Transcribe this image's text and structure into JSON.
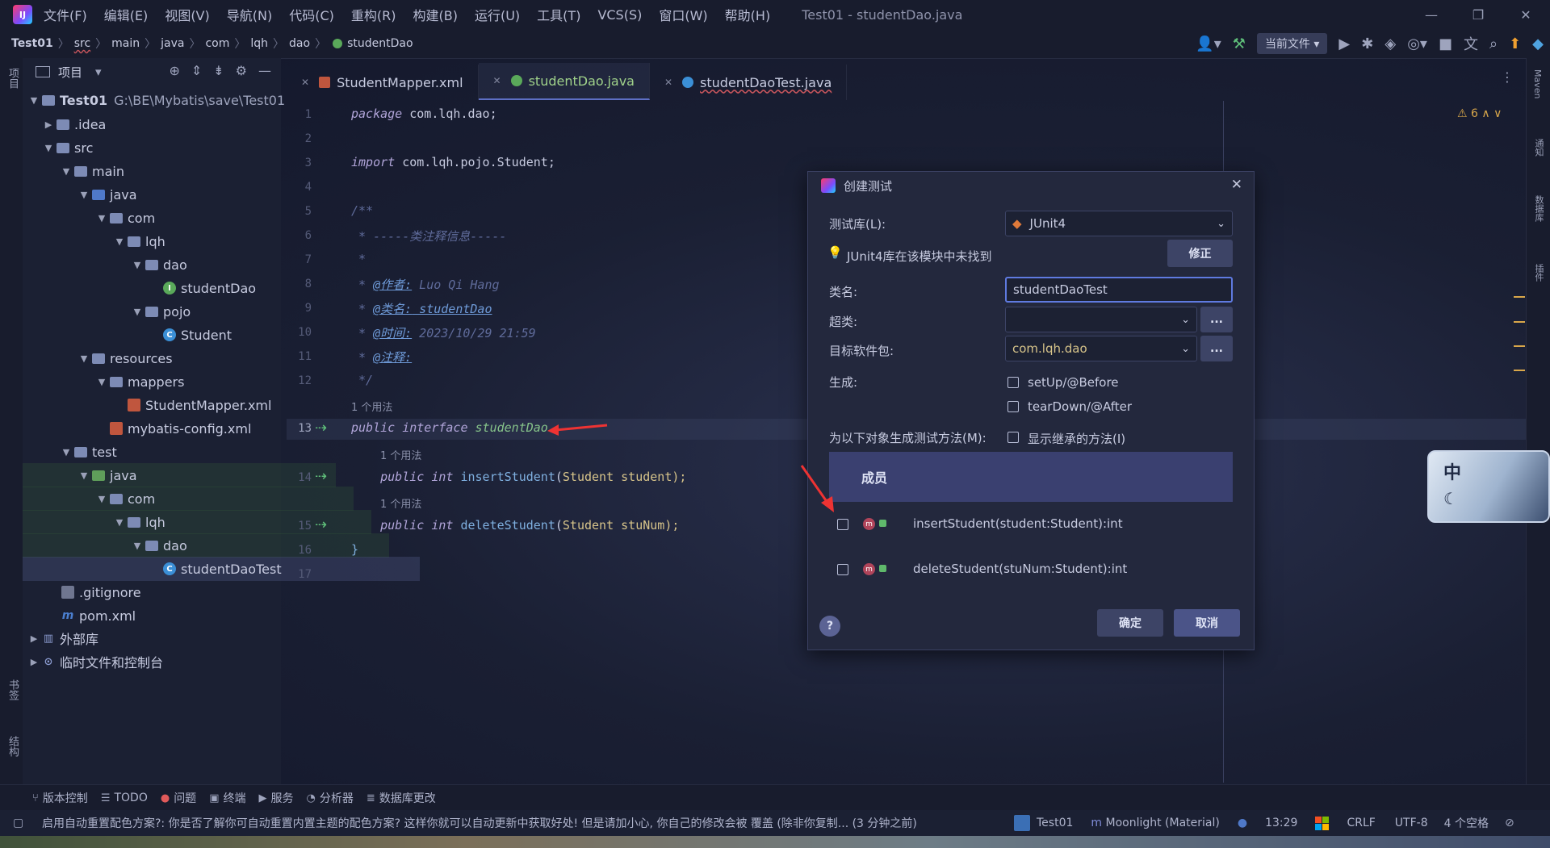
{
  "window": {
    "title": "Test01 - studentDao.java",
    "menu": [
      "文件(F)",
      "编辑(E)",
      "视图(V)",
      "导航(N)",
      "代码(C)",
      "重构(R)",
      "构建(B)",
      "运行(U)",
      "工具(T)",
      "VCS(S)",
      "窗口(W)",
      "帮助(H)"
    ]
  },
  "breadcrumb": [
    "Test01",
    "src",
    "main",
    "java",
    "com",
    "lqh",
    "dao",
    "studentDao"
  ],
  "toolbar": {
    "run_config": "当前文件"
  },
  "left_strip": {
    "project_label": "项目",
    "bookmarks_label": "书签",
    "structure_label": "结构"
  },
  "right_strip": {
    "maven": "Maven",
    "notifications": "通知",
    "database": "数据库",
    "plugins": "插件"
  },
  "project_panel": {
    "title": "项目",
    "root_name": "Test01",
    "root_path": "G:\\BE\\Mybatis\\save\\Test01",
    "items": [
      {
        "label": ".idea"
      },
      {
        "label": "src"
      },
      {
        "label": "main"
      },
      {
        "label": "java"
      },
      {
        "label": "com"
      },
      {
        "label": "lqh"
      },
      {
        "label": "dao"
      },
      {
        "label": "studentDao"
      },
      {
        "label": "pojo"
      },
      {
        "label": "Student"
      },
      {
        "label": "resources"
      },
      {
        "label": "mappers"
      },
      {
        "label": "StudentMapper.xml"
      },
      {
        "label": "mybatis-config.xml"
      },
      {
        "label": "test"
      },
      {
        "label": "java"
      },
      {
        "label": "com"
      },
      {
        "label": "lqh"
      },
      {
        "label": "dao"
      },
      {
        "label": "studentDaoTest"
      },
      {
        "label": ".gitignore"
      },
      {
        "label": "pom.xml"
      },
      {
        "label": "外部库"
      },
      {
        "label": "临时文件和控制台"
      }
    ]
  },
  "tabs": [
    {
      "label": "StudentMapper.xml"
    },
    {
      "label": "studentDao.java"
    },
    {
      "label": "studentDaoTest.java"
    }
  ],
  "editor": {
    "warnings": "6",
    "lines": {
      "l1_kw": "package",
      "l1_rest": " com.lqh.dao;",
      "l3_kw": "import",
      "l3_rest": " com.lqh.pojo.Student;",
      "l5": "/**",
      "l6": " * -----类注释信息-----",
      "l7": " *",
      "l8_tag": "@作者:",
      "l8_val": " Luo Qi Hang",
      "l9_tag": "@类名:",
      "l9_val": " studentDao",
      "l10_tag": "@时间:",
      "l10_val": " 2023/10/29 21:59",
      "l11_tag": "@注释:",
      "l12": " */",
      "usage1": "1 个用法",
      "l13_kw": "public interface",
      "l13_name": "studentDao",
      "usage2": "1 个用法",
      "l14_kw": "public int",
      "l14_method": "insertStudent",
      "l14_type": "Student",
      "l14_param": " student);",
      "usage3": "1 个用法",
      "l15_kw": "public int",
      "l15_method": "deleteStudent",
      "l15_type": "Student",
      "l15_param": " stuNum);",
      "l16": "}"
    }
  },
  "dialog": {
    "title": "创建测试",
    "test_lib_label": "测试库(L):",
    "test_lib_value": "JUnit4",
    "warning_text": "JUnit4库在该模块中未找到",
    "fix_button": "修正",
    "class_name_label": "类名:",
    "class_name_value": "studentDaoTest",
    "superclass_label": "超类:",
    "superclass_value": "",
    "package_label": "目标软件包:",
    "package_value": "com.lqh.dao",
    "browse_label": "...",
    "generate_label": "生成:",
    "setup_label": "setUp/@Before",
    "teardown_label": "tearDown/@After",
    "methods_label": "为以下对象生成测试方法(M):",
    "inherited_label": "显示继承的方法(I)",
    "members_header": "成员",
    "members": [
      {
        "label": "insertStudent(student:Student):int"
      },
      {
        "label": "deleteStudent(stuNum:Student):int"
      }
    ],
    "ok_button": "确定",
    "cancel_button": "取消",
    "help_button": "?"
  },
  "bottom_tools": [
    "版本控制",
    "TODO",
    "问题",
    "终端",
    "服务",
    "分析器",
    "数据库更改"
  ],
  "status": {
    "message": "启用自动重置配色方案?: 你是否了解你可自动重置内置主题的配色方案? 这样你就可以自动更新中获取好处! 但是请加小心, 你自己的修改会被 覆盖 (除非你复制... (3 分钟之前)",
    "project": "Test01",
    "theme": "Moonlight (Material)",
    "time": "13:29",
    "line_sep": "CRLF",
    "encoding": "UTF-8",
    "indent": "4 个空格"
  },
  "widget_char": "中",
  "colors": {
    "accent": "#5e6fc4",
    "background": "#1a1f33",
    "dialog": "#23283d"
  }
}
